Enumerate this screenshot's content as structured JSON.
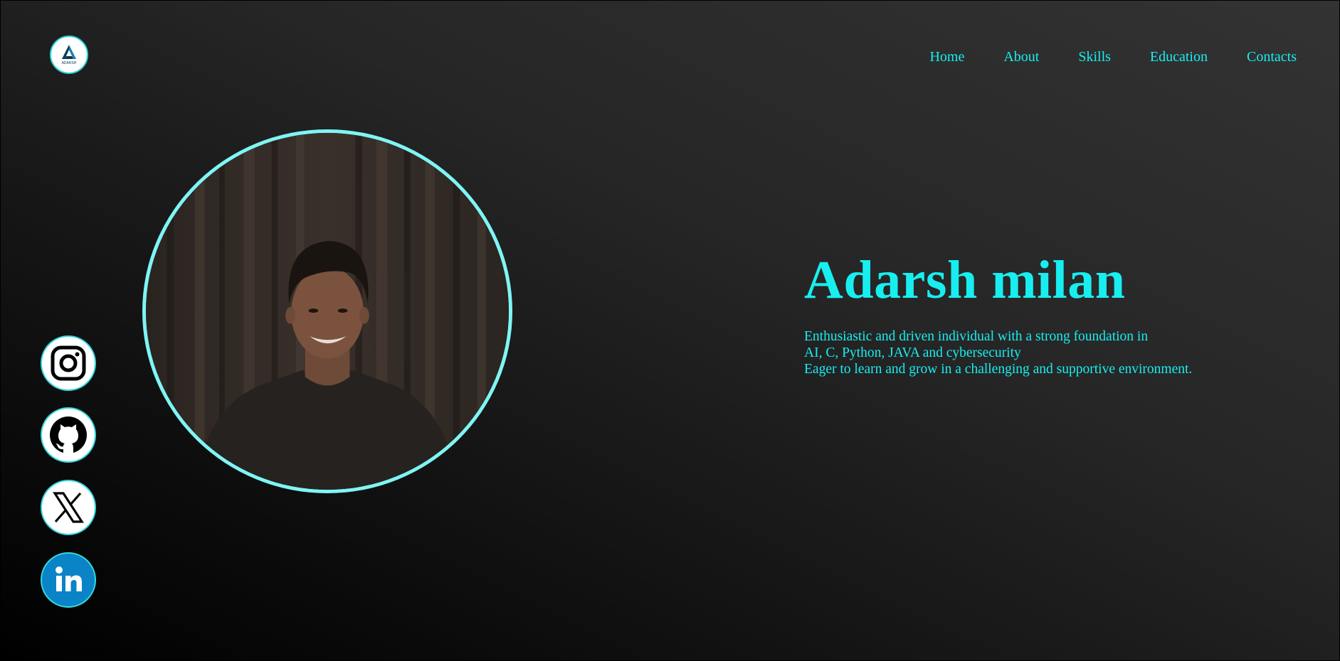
{
  "logo": {
    "text": "ADARSH",
    "icon": "brand-logo-icon"
  },
  "nav": {
    "items": [
      {
        "label": "Home"
      },
      {
        "label": "About"
      },
      {
        "label": "Skills"
      },
      {
        "label": "Education"
      },
      {
        "label": "Contacts"
      }
    ]
  },
  "hero": {
    "name": "Adarsh milan",
    "description": [
      "Enthusiastic and driven individual with a strong foundation in",
      "AI, C, Python, JAVA and cybersecurity",
      "Eager to learn and grow in a challenging and supportive environment."
    ]
  },
  "social": [
    {
      "icon": "instagram-icon"
    },
    {
      "icon": "github-icon"
    },
    {
      "icon": "x-twitter-icon"
    },
    {
      "icon": "linkedin-icon"
    }
  ],
  "colors": {
    "accent": "#18eef0",
    "portrait_border": "#7ff5f5",
    "linkedin": "#0a84c6",
    "background_top": "#333333",
    "background_bottom": "#000000"
  }
}
